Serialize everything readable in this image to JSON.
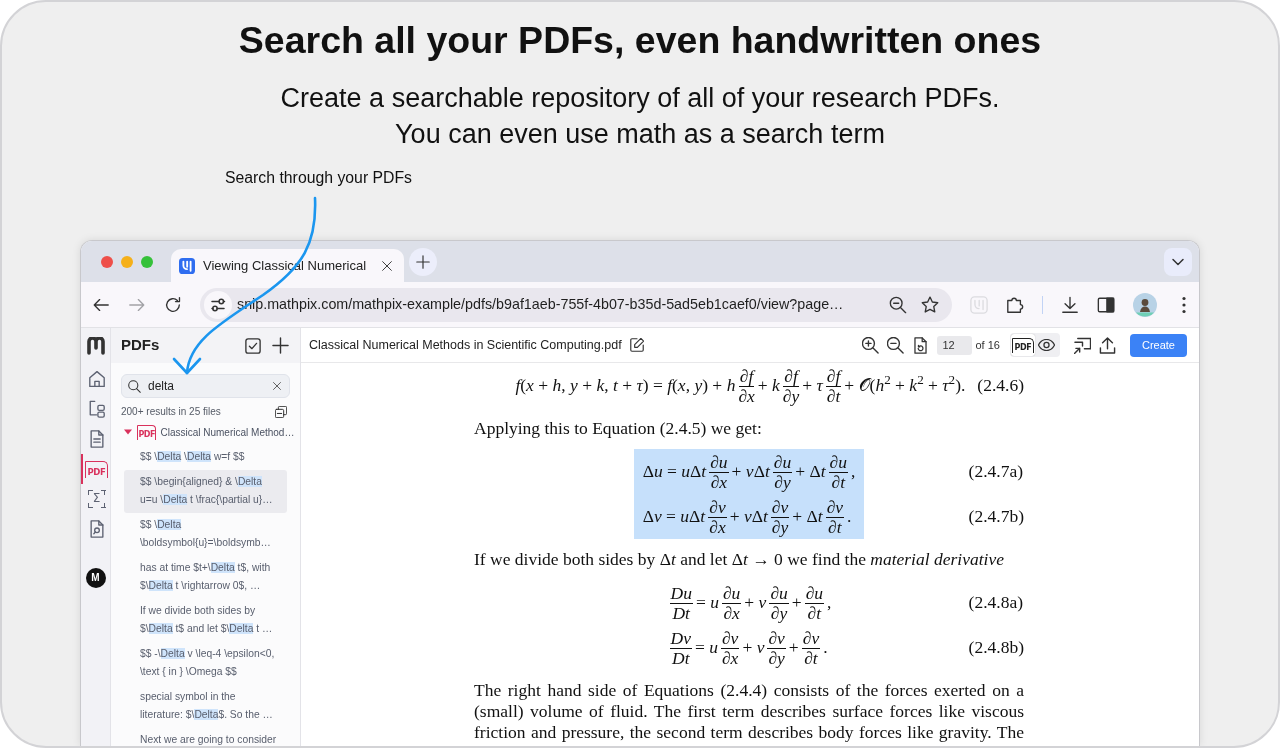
{
  "promo": {
    "title": "Search all your PDFs, even handwritten ones",
    "subtitle_lines": [
      "Create a searchable repository of all of your research PDFs.",
      "You can even use math as a search term"
    ],
    "annotation": "Search through your PDFs"
  },
  "browser": {
    "tab": {
      "title": "Viewing Classical Numerical"
    },
    "nav_buttons": [
      {
        "kind": "back",
        "disabled": false
      },
      {
        "kind": "forward",
        "disabled": true
      },
      {
        "kind": "reload",
        "disabled": false
      }
    ],
    "url": "snip.mathpix.com/mathpix-example/pdfs/b9af1aeb-755f-4b07-b35d-5ad5eb1caef0/view?page…",
    "extensions": [
      {
        "kind": "mathpix",
        "disabled": true
      },
      {
        "kind": "puzzle",
        "disabled": false
      }
    ]
  },
  "rail": {
    "items": [
      {
        "kind": "home",
        "selected": false
      },
      {
        "kind": "tree",
        "selected": false
      },
      {
        "kind": "document",
        "selected": false
      },
      {
        "kind": "pdf",
        "label": "PDF",
        "selected": true
      },
      {
        "kind": "math",
        "label": "Σ",
        "selected": false
      },
      {
        "kind": "search",
        "selected": false
      }
    ],
    "avatar": "M"
  },
  "sidebar": {
    "title": "PDFs",
    "search": {
      "value": "delta"
    },
    "summary": "200+ results in 25 files",
    "files": [
      {
        "icon_label": "PDF",
        "name": "Classical Numerical Method…",
        "expanded": true,
        "results": [
          {
            "selected": false,
            "segments": [
              {
                "text": "$$ \\",
                "highlighted": false
              },
              {
                "text": "Delta",
                "highlighted": true
              },
              {
                "text": " \\",
                "highlighted": false
              },
              {
                "text": "Delta",
                "highlighted": true
              },
              {
                "text": " w=f $$",
                "highlighted": false
              }
            ]
          },
          {
            "selected": true,
            "segments": [
              {
                "text": "$$ \\begin{aligned} & \\",
                "highlighted": false
              },
              {
                "text": "Delta",
                "highlighted": true
              },
              {
                "text": " u=u \\",
                "highlighted": false
              },
              {
                "text": "Delta",
                "highlighted": true
              },
              {
                "text": " t \\frac{\\partial u}…",
                "highlighted": false
              }
            ]
          },
          {
            "selected": false,
            "segments": [
              {
                "text": "$$ \\",
                "highlighted": false
              },
              {
                "text": "Delta",
                "highlighted": true
              },
              {
                "text": " \\boldsymbol{u}=\\boldsymb…",
                "highlighted": false
              }
            ]
          },
          {
            "selected": false,
            "segments": [
              {
                "text": "has at time $t+\\",
                "highlighted": false
              },
              {
                "text": "Delta",
                "highlighted": true
              },
              {
                "text": " t$, with $\\",
                "highlighted": false
              },
              {
                "text": "Delta",
                "highlighted": true
              },
              {
                "text": " t \\rightarrow 0$, …",
                "highlighted": false
              }
            ]
          },
          {
            "selected": false,
            "segments": [
              {
                "text": "If we divide both sides by $\\",
                "highlighted": false
              },
              {
                "text": "Delta",
                "highlighted": true
              },
              {
                "text": " t$ and let $\\",
                "highlighted": false
              },
              {
                "text": "Delta",
                "highlighted": true
              },
              {
                "text": " t …",
                "highlighted": false
              }
            ]
          },
          {
            "selected": false,
            "segments": [
              {
                "text": "$$ -\\",
                "highlighted": false
              },
              {
                "text": "Delta",
                "highlighted": true
              },
              {
                "text": " v \\leq-4 \\epsilon<0, \\text { in } \\Omega $$",
                "highlighted": false
              }
            ]
          },
          {
            "selected": false,
            "segments": [
              {
                "text": "special symbol in the literature: $\\",
                "highlighted": false
              },
              {
                "text": "Delta",
                "highlighted": true
              },
              {
                "text": "$. So the …",
                "highlighted": false
              }
            ]
          },
          {
            "selected": false,
            "segments": [
              {
                "text": "Next we are going to consider",
                "highlighted": false
              }
            ]
          }
        ]
      }
    ]
  },
  "viewer": {
    "file_name": "Classical Numerical Methods in Scientific Computing.pdf",
    "page": "12",
    "page_total": "of 16",
    "view_modes": [
      {
        "kind": "pdf",
        "label": "PDF",
        "selected": true
      },
      {
        "kind": "preview",
        "selected": false
      }
    ],
    "create_button": "Create",
    "content": [
      {
        "kind": "display",
        "highlighted": false,
        "equations": [
          {
            "number": "(2.4.6)",
            "parts": [
              {
                "kind": "text",
                "text": "*f*(*x* + *h*, *y* + *k*, *t* + *τ*) = *f*(*x*, *y*) + *h*"
              },
              {
                "kind": "frac",
                "num": "∂*f*",
                "den": "∂*x*"
              },
              {
                "kind": "text",
                "text": "+ *k*"
              },
              {
                "kind": "frac",
                "num": "∂*f*",
                "den": "∂*y*"
              },
              {
                "kind": "text",
                "text": "+ *τ*"
              },
              {
                "kind": "frac",
                "num": "∂*f*",
                "den": "∂*t*"
              },
              {
                "kind": "text",
                "text": "+ 𝒪(*h*$^{2}$ + *k*$^{2}$ + *τ*$^{2}$)."
              }
            ]
          }
        ]
      },
      {
        "kind": "paragraph",
        "text": "Applying this to Equation (2.4.5) we get:"
      },
      {
        "kind": "display",
        "highlighted": true,
        "equations": [
          {
            "number": "(2.4.7a)",
            "parts": [
              {
                "kind": "text",
                "text": "Δ"
              },
              {
                "kind": "text",
                "text": "*u* = *u*"
              },
              {
                "kind": "text",
                "text": "Δ"
              },
              {
                "kind": "text",
                "text": "*t*"
              },
              {
                "kind": "frac",
                "num": "∂*u*",
                "den": "∂*x*"
              },
              {
                "kind": "text",
                "text": "+ *v*"
              },
              {
                "kind": "text",
                "text": "Δ"
              },
              {
                "kind": "text",
                "text": "*t*"
              },
              {
                "kind": "frac",
                "num": "∂*u*",
                "den": "∂*y*"
              },
              {
                "kind": "text",
                "text": "+ Δ"
              },
              {
                "kind": "text",
                "text": "*t*"
              },
              {
                "kind": "frac",
                "num": "∂*u*",
                "den": "∂*t*"
              },
              {
                "kind": "text",
                "text": ","
              }
            ]
          },
          {
            "number": "(2.4.7b)",
            "parts": [
              {
                "kind": "text",
                "text": "Δ"
              },
              {
                "kind": "text",
                "text": "*v* = *u*"
              },
              {
                "kind": "text",
                "text": "Δ"
              },
              {
                "kind": "text",
                "text": "*t*"
              },
              {
                "kind": "frac",
                "num": "∂*v*",
                "den": "∂*x*"
              },
              {
                "kind": "text",
                "text": "+ *v*"
              },
              {
                "kind": "text",
                "text": "Δ"
              },
              {
                "kind": "text",
                "text": "*t*"
              },
              {
                "kind": "frac",
                "num": "∂*v*",
                "den": "∂*y*"
              },
              {
                "kind": "text",
                "text": "+ Δ"
              },
              {
                "kind": "text",
                "text": "*t*"
              },
              {
                "kind": "frac",
                "num": "∂*v*",
                "den": "∂*t*"
              },
              {
                "kind": "text",
                "text": "."
              }
            ]
          }
        ]
      },
      {
        "kind": "paragraph",
        "runs": [
          {
            "text": "If we divide both sides by Δ",
            "italic": false
          },
          {
            "text": "t",
            "italic": true
          },
          {
            "text": " and let Δ",
            "italic": false
          },
          {
            "text": "t",
            "italic": true
          },
          {
            "text": " → 0 we find the ",
            "italic": false
          },
          {
            "text": "material derivative",
            "italic": true
          }
        ]
      },
      {
        "kind": "display",
        "highlighted": false,
        "equations": [
          {
            "number": "(2.4.8a)",
            "parts": [
              {
                "kind": "frac",
                "num": "*Du*",
                "den": "*Dt*"
              },
              {
                "kind": "text",
                "text": "= *u*"
              },
              {
                "kind": "frac",
                "num": "∂*u*",
                "den": "∂*x*"
              },
              {
                "kind": "text",
                "text": "+ *v*"
              },
              {
                "kind": "frac",
                "num": "∂*u*",
                "den": "∂*y*"
              },
              {
                "kind": "text",
                "text": "+"
              },
              {
                "kind": "frac",
                "num": "∂*u*",
                "den": "∂*t*"
              },
              {
                "kind": "text",
                "text": ","
              }
            ]
          },
          {
            "number": "(2.4.8b)",
            "parts": [
              {
                "kind": "frac",
                "num": "*Dv*",
                "den": "*Dt*"
              },
              {
                "kind": "text",
                "text": "= *u*"
              },
              {
                "kind": "frac",
                "num": "∂*v*",
                "den": "∂*x*"
              },
              {
                "kind": "text",
                "text": "+ *v*"
              },
              {
                "kind": "frac",
                "num": "∂*v*",
                "den": "∂*y*"
              },
              {
                "kind": "text",
                "text": "+"
              },
              {
                "kind": "frac",
                "num": "∂*v*",
                "den": "∂*t*"
              },
              {
                "kind": "text",
                "text": "."
              }
            ]
          }
        ]
      },
      {
        "kind": "paragraph",
        "text": "The right hand side of Equations (2.4.4) consists of the forces exerted on a (small) volume of fluid.  The first term describes surface forces like viscous friction and pressure, the second term describes body forces like gravity. The"
      }
    ]
  }
}
